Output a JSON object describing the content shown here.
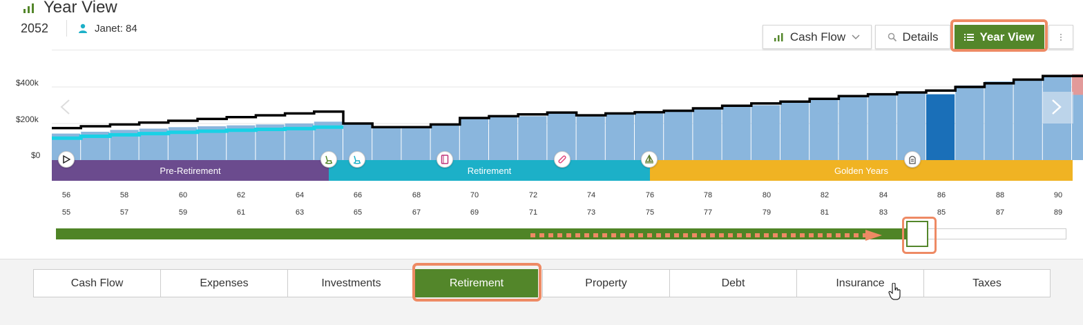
{
  "header": {
    "title": "Year View",
    "year": "2052",
    "person_label": "Janet:",
    "person_age": "84",
    "title_icon": "bar-chart-icon",
    "person_icon": "person-icon"
  },
  "toolbar": {
    "cash_flow_label": "Cash Flow",
    "details_label": "Details",
    "year_view_label": "Year View",
    "more_icon": "vertical-dots-icon"
  },
  "chart_data": {
    "type": "bar",
    "title": "",
    "ylabel": "",
    "y_tick_labels": [
      "$400k",
      "$200k",
      "$0"
    ],
    "ylim": [
      0,
      470000
    ],
    "age_axis_top": [
      "56",
      "58",
      "60",
      "62",
      "64",
      "66",
      "68",
      "70",
      "72",
      "74",
      "76",
      "78",
      "80",
      "82",
      "84",
      "86",
      "88",
      "90"
    ],
    "age_axis_bottom": [
      "55",
      "57",
      "59",
      "61",
      "63",
      "65",
      "67",
      "69",
      "71",
      "73",
      "75",
      "77",
      "79",
      "81",
      "83",
      "85",
      "87",
      "89"
    ],
    "categories": [
      "55",
      "56",
      "57",
      "58",
      "59",
      "60",
      "61",
      "62",
      "63",
      "64",
      "65",
      "66",
      "67",
      "68",
      "69",
      "70",
      "71",
      "72",
      "73",
      "74",
      "75",
      "76",
      "77",
      "78",
      "79",
      "80",
      "81",
      "82",
      "83",
      "84",
      "85",
      "86",
      "87",
      "88",
      "89",
      "90"
    ],
    "series": [
      {
        "values": [
          175000,
          185000,
          195000,
          205000,
          215000,
          225000,
          235000,
          245000,
          255000,
          265000,
          200000,
          180000,
          180000,
          195000,
          230000,
          240000,
          250000,
          260000,
          245000,
          255000,
          262000,
          270000,
          283000,
          297000,
          310000,
          320000,
          335000,
          350000,
          360000,
          370000,
          380000,
          400000,
          420000,
          440000,
          460000,
          460000
        ]
      },
      {
        "values": [
          145000,
          155000,
          165000,
          172000,
          180000,
          185000,
          190000,
          195000,
          200000,
          210000,
          205000,
          180000,
          180000,
          195000,
          225000,
          235000,
          240000,
          255000,
          238000,
          250000,
          258000,
          265000,
          278000,
          292000,
          300000,
          315000,
          330000,
          345000,
          360000,
          370000,
          360000,
          408000,
          430000,
          445000,
          465000,
          470000
        ]
      },
      {
        "values": [
          120000,
          130000,
          138000,
          145000,
          152000,
          158000,
          163000,
          168000,
          172000,
          180000
        ]
      }
    ],
    "selected_year_age": "85",
    "phases": [
      {
        "label": "Pre-Retirement",
        "color": "#6b4b8e"
      },
      {
        "label": "Retirement",
        "color": "#1cb0c8"
      },
      {
        "label": "Golden Years",
        "color": "#f0b323"
      }
    ],
    "bar_color": "#8ab6dd",
    "selected_bar_color": "#1a6fb8",
    "line_color": "#000000",
    "cyan_line_color": "#19d1e6"
  },
  "event_markers": [
    {
      "icon": "play-icon"
    },
    {
      "icon": "rocking-chair-icon"
    },
    {
      "icon": "rocking-chair-icon"
    },
    {
      "icon": "book-icon"
    },
    {
      "icon": "bandage-icon"
    },
    {
      "icon": "sailboat-icon"
    },
    {
      "icon": "headstone-icon"
    }
  ],
  "slider": {
    "progress": 0.84
  },
  "tabs": [
    {
      "label": "Cash Flow"
    },
    {
      "label": "Expenses"
    },
    {
      "label": "Investments"
    },
    {
      "label": "Retirement",
      "active": true
    },
    {
      "label": "Property"
    },
    {
      "label": "Debt"
    },
    {
      "label": "Insurance"
    },
    {
      "label": "Taxes"
    }
  ],
  "colors": {
    "accent": "#53862a",
    "highlight": "#ee8a64"
  }
}
